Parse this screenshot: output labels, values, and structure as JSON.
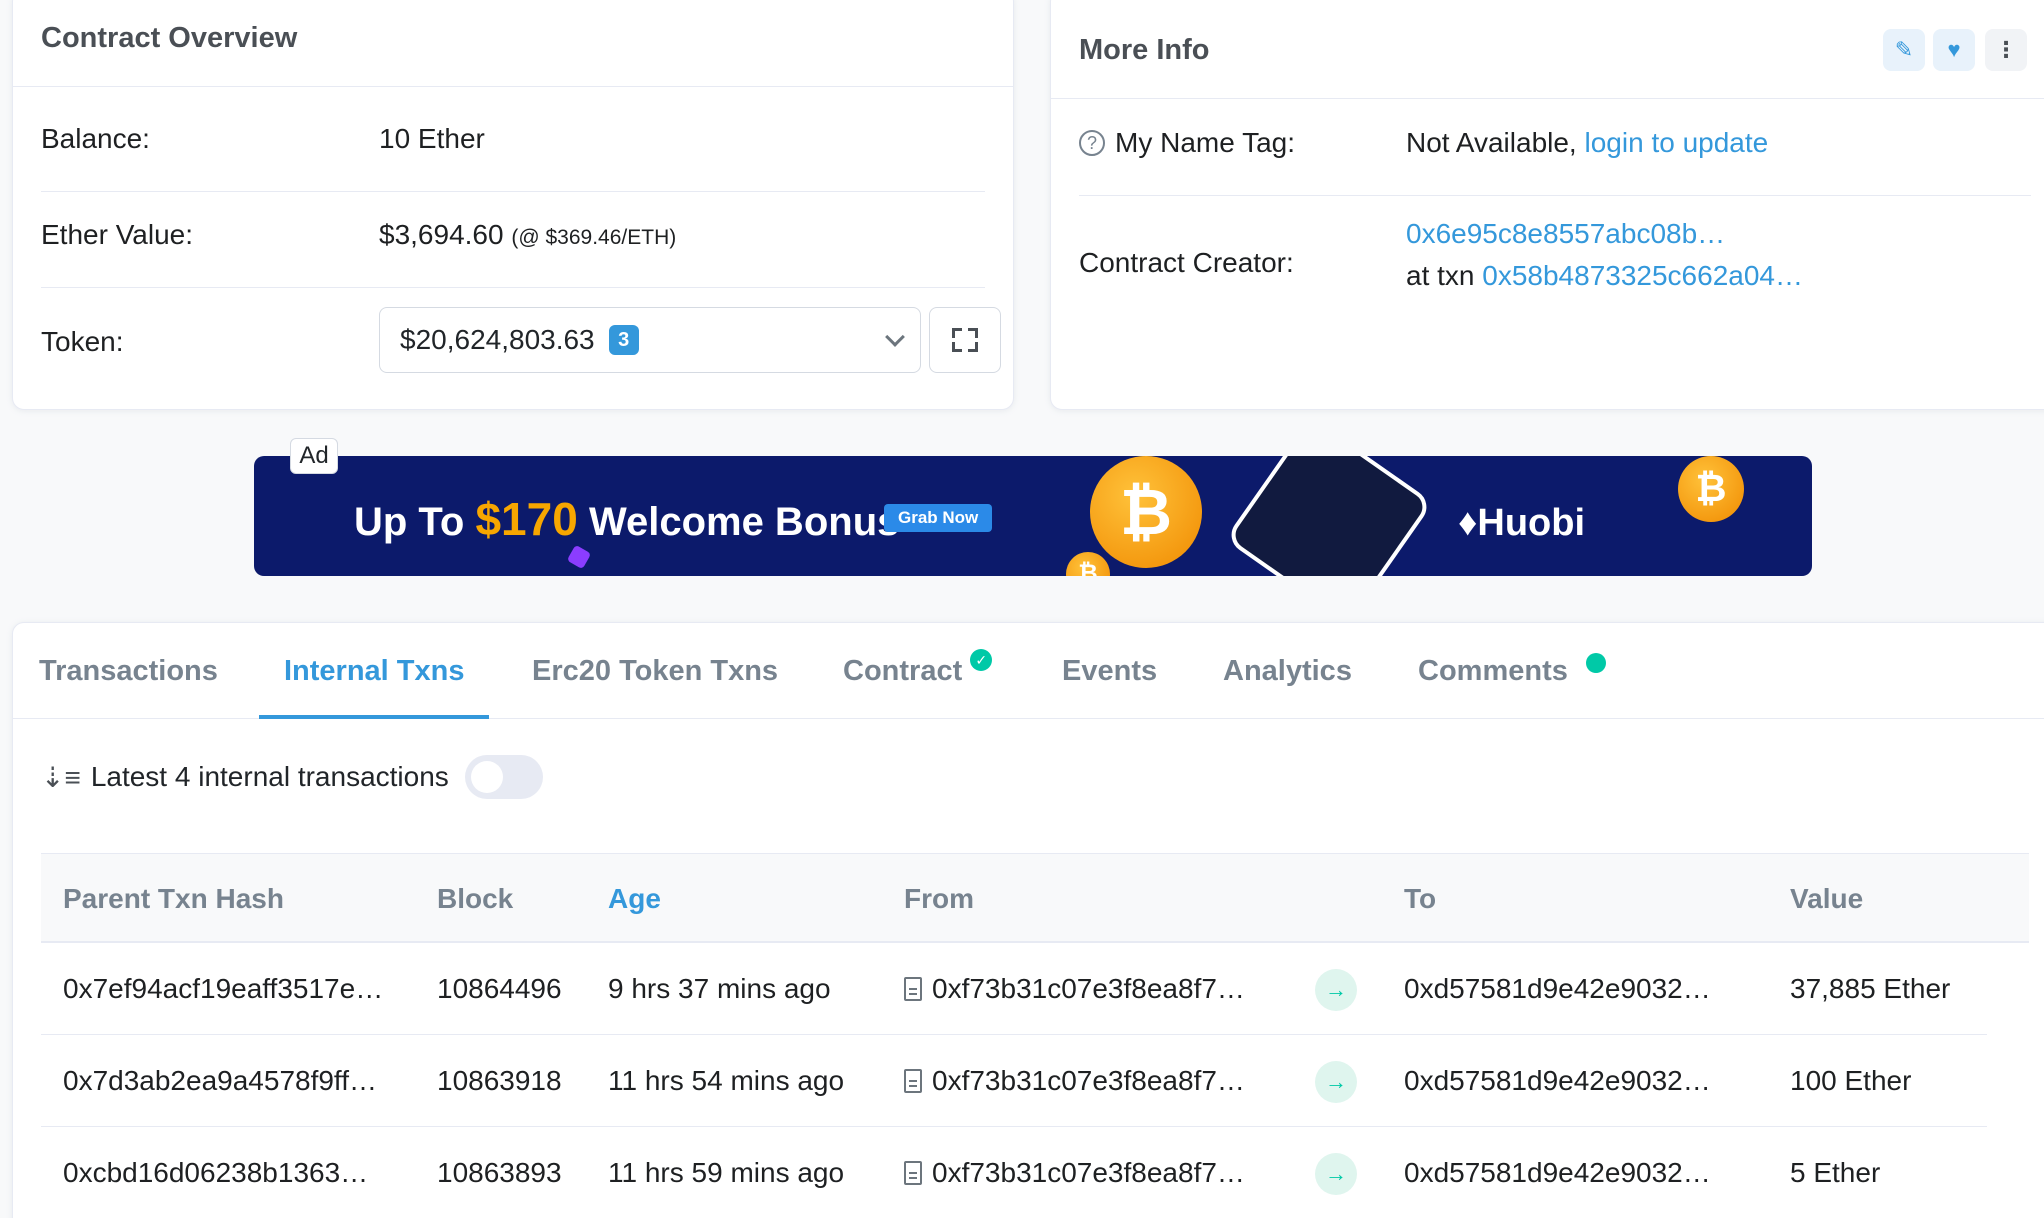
{
  "overview": {
    "title": "Contract Overview",
    "balance_label": "Balance:",
    "balance_value": "10 Ether",
    "ether_value_label": "Ether Value:",
    "ether_value": "$3,694.60",
    "ether_rate": "(@ $369.46/ETH)",
    "token_label": "Token:",
    "token_value": "$20,624,803.63",
    "token_count": "3"
  },
  "more_info": {
    "title": "More Info",
    "name_tag_label": "My Name Tag:",
    "name_tag_value": "Not Available,",
    "name_tag_link": "login to update",
    "creator_label": "Contract Creator:",
    "creator_address": "0x6e95c8e8557abc08b…",
    "creator_txn_prefix": "at txn",
    "creator_txn": "0x58b4873325c662a04…"
  },
  "ad": {
    "tag": "Ad",
    "text_pre": "Up To",
    "amount": "$170",
    "text_post": "Welcome Bonus",
    "button": "Grab Now",
    "brand": "Huobi"
  },
  "tabs": [
    {
      "label": "Transactions"
    },
    {
      "label": "Internal Txns"
    },
    {
      "label": "Erc20 Token Txns"
    },
    {
      "label": "Contract"
    },
    {
      "label": "Events"
    },
    {
      "label": "Analytics"
    },
    {
      "label": "Comments"
    }
  ],
  "list": {
    "summary": "Latest 4 internal transactions",
    "columns": [
      "Parent Txn Hash",
      "Block",
      "Age",
      "From",
      "To",
      "Value"
    ],
    "rows": [
      {
        "hash": "0x7ef94acf19eaff3517e…",
        "block": "10864496",
        "age": "9 hrs 37 mins ago",
        "from": "0xf73b31c07e3f8ea8f7…",
        "to": "0xd57581d9e42e9032…",
        "value": "37,885 Ether"
      },
      {
        "hash": "0x7d3ab2ea9a4578f9ff…",
        "block": "10863918",
        "age": "11 hrs 54 mins ago",
        "from": "0xf73b31c07e3f8ea8f7…",
        "to": "0xd57581d9e42e9032…",
        "value": "100 Ether"
      },
      {
        "hash": "0xcbd16d06238b1363…",
        "block": "10863893",
        "age": "11 hrs 59 mins ago",
        "from": "0xf73b31c07e3f8ea8f7…",
        "to": "0xd57581d9e42e9032…",
        "value": "5 Ether"
      }
    ]
  },
  "colors": {
    "accent": "#3498db",
    "success": "#00c9a7",
    "muted": "#77838f"
  }
}
